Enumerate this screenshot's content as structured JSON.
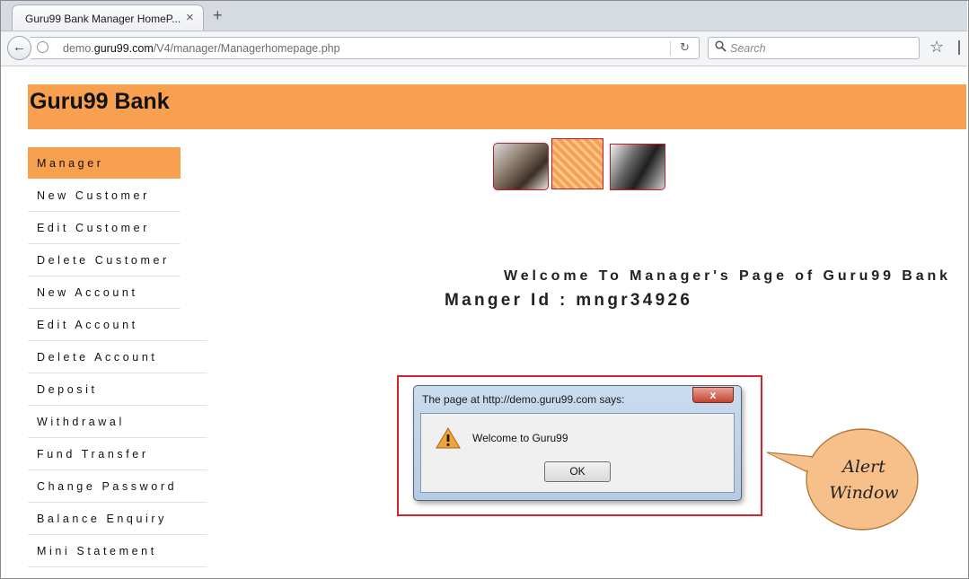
{
  "browser": {
    "tab_title": "Guru99 Bank Manager HomeP...",
    "tab_close": "×",
    "new_tab": "+",
    "url_prefix": "demo.",
    "url_host": "guru99.com",
    "url_path": "/V4/manager/Managerhomepage.php",
    "reload": "↻",
    "search_placeholder": "Search",
    "back": "←",
    "star": "☆"
  },
  "page": {
    "bank_title": "Guru99 Bank",
    "welcome": "Welcome To Manager's Page of Guru99 Bank",
    "manager_id": "Manger Id : mngr34926"
  },
  "menu": {
    "items": [
      "Manager",
      "New Customer",
      "Edit Customer",
      "Delete Customer",
      "New Account",
      "Edit Account",
      "Delete Account",
      "Deposit",
      "Withdrawal",
      "Fund Transfer",
      "Change Password",
      "Balance Enquiry",
      "Mini Statement"
    ],
    "active_index": 0
  },
  "alert": {
    "title": "The page at http://demo.guru99.com says:",
    "message": "Welcome to Guru99",
    "ok_label": "OK",
    "close_label": "x"
  },
  "callout": {
    "line1": "Alert",
    "line2": "Window",
    "fill_color": "#f7c08a",
    "border_color": "#b07a3a"
  },
  "colors": {
    "accent": "#f7a04f",
    "highlight_border": "#d6232f"
  }
}
